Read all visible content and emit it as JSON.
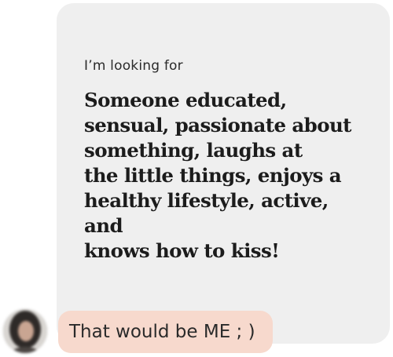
{
  "prompt": {
    "question": "I’m looking for",
    "answer_lines": [
      "Someone educated,",
      "sensual, passionate about",
      "something, laughs at",
      "the little things, enjoys a",
      "healthy lifestyle, active, and",
      "knows how to kiss!"
    ]
  },
  "reply": {
    "text": "That would be ME ; )"
  },
  "colors": {
    "card_background": "#efefef",
    "reply_background": "#f7d9cd",
    "text": "#1c1c1c"
  },
  "icons": {
    "avatar": "user-avatar-photo"
  }
}
